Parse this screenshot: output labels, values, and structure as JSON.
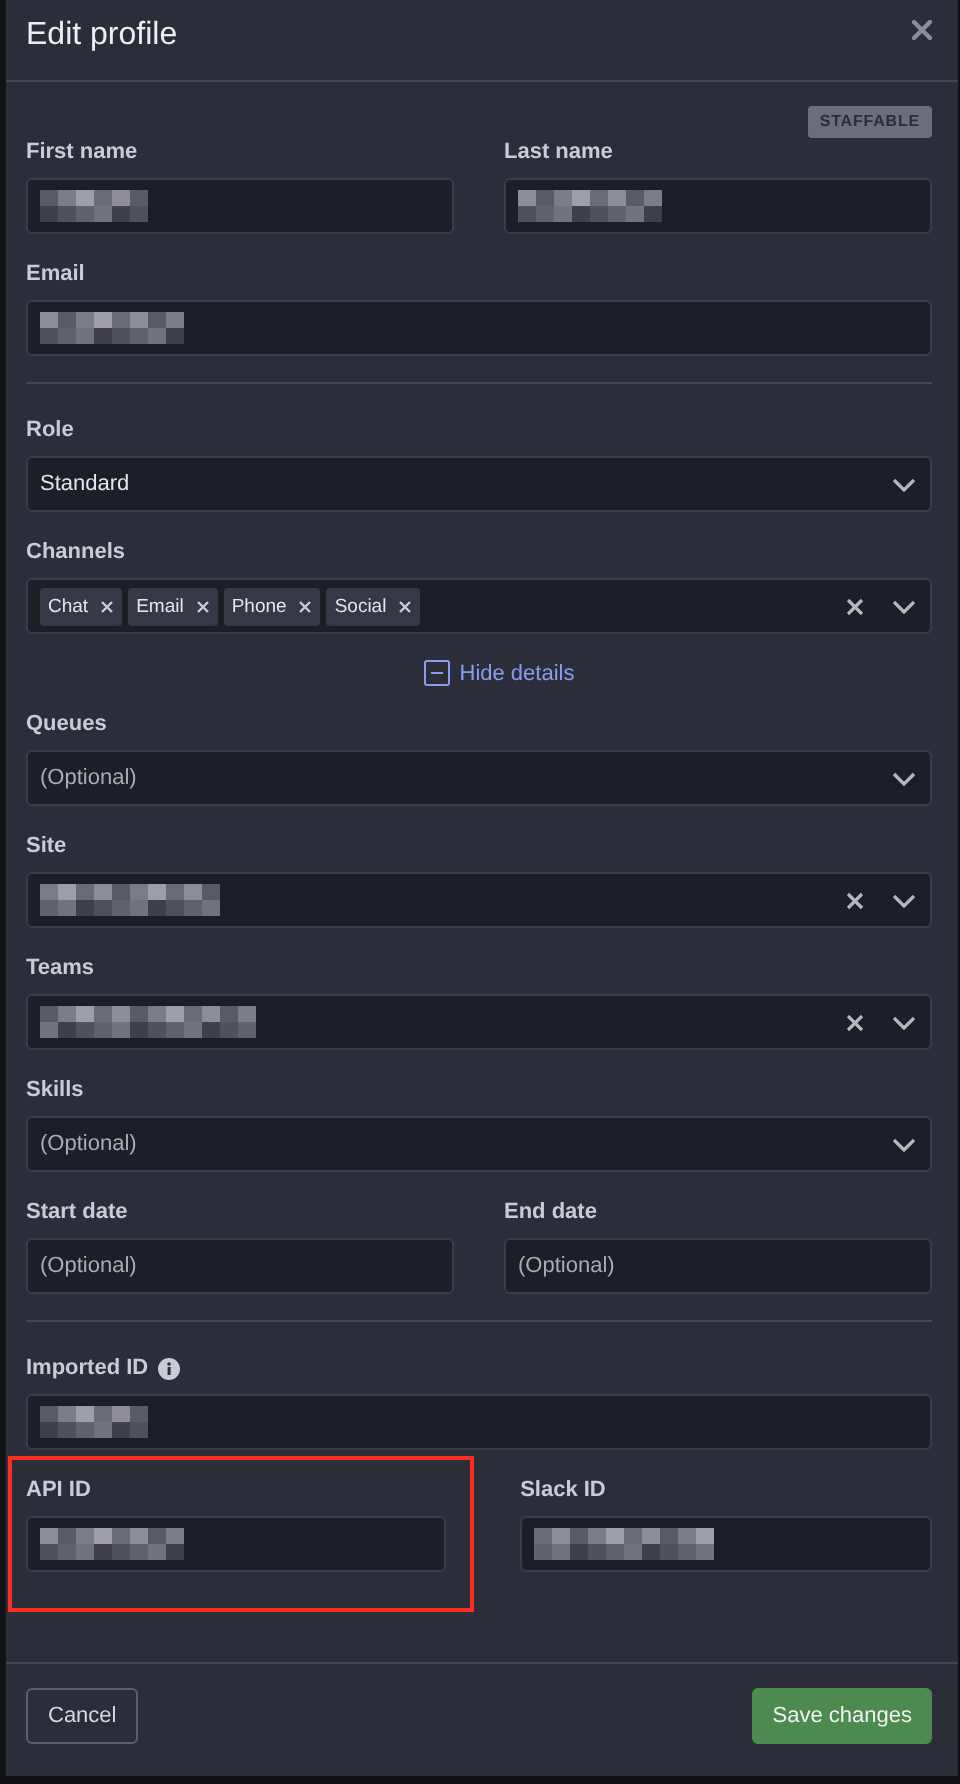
{
  "dialog": {
    "title": "Edit profile",
    "badge": "STAFFABLE"
  },
  "sections": [
    {
      "rows": [
        {
          "kind": "fields",
          "fields": [
            {
              "label": "First name",
              "kind": "text",
              "blurred": true
            },
            {
              "label": "Last name",
              "kind": "text",
              "blurred": true
            }
          ]
        },
        {
          "kind": "fields",
          "fields": [
            {
              "label": "Email",
              "kind": "text",
              "blurred": true
            }
          ]
        }
      ]
    },
    {
      "rows": [
        {
          "kind": "fields",
          "fields": [
            {
              "label": "Role",
              "kind": "select",
              "value": "Standard"
            }
          ]
        },
        {
          "kind": "fields",
          "fields": [
            {
              "label": "Channels",
              "kind": "select",
              "clearable": true,
              "chips": [
                "Chat",
                "Email",
                "Phone",
                "Social"
              ]
            }
          ]
        },
        {
          "kind": "toggle",
          "label": "Hide details",
          "expanded": true
        },
        {
          "kind": "fields",
          "fields": [
            {
              "label": "Queues",
              "kind": "select",
              "placeholder": "(Optional)"
            }
          ]
        },
        {
          "kind": "fields",
          "fields": [
            {
              "label": "Site",
              "kind": "select",
              "clearable": true,
              "blurred": true
            }
          ]
        },
        {
          "kind": "fields",
          "fields": [
            {
              "label": "Teams",
              "kind": "select",
              "clearable": true,
              "blurred": true
            }
          ]
        },
        {
          "kind": "fields",
          "fields": [
            {
              "label": "Skills",
              "kind": "select",
              "placeholder": "(Optional)"
            }
          ]
        },
        {
          "kind": "fields",
          "fields": [
            {
              "label": "Start date",
              "kind": "text",
              "placeholder": "(Optional)"
            },
            {
              "label": "End date",
              "kind": "text",
              "placeholder": "(Optional)"
            }
          ]
        }
      ]
    },
    {
      "rows": [
        {
          "kind": "fields",
          "fields": [
            {
              "label": "Imported ID",
              "kind": "text",
              "info": true,
              "blurred": true
            }
          ]
        },
        {
          "kind": "fields",
          "fields": [
            {
              "label": "API ID",
              "kind": "text",
              "blurred": true,
              "highlighted": true
            },
            {
              "label": "Slack ID",
              "kind": "text",
              "blurred": true
            }
          ]
        }
      ]
    }
  ],
  "buttons": [
    {
      "label": "Cancel",
      "kind": "secondary"
    },
    {
      "label": "Save changes",
      "kind": "primary"
    }
  ]
}
